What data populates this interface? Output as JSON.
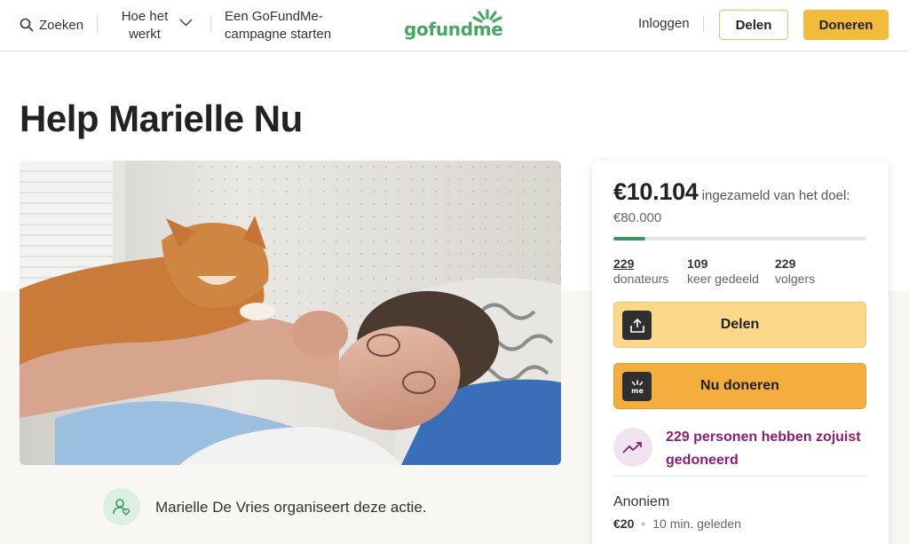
{
  "header": {
    "search_label": "Zoeken",
    "how_it_works_label": "Hoe het werkt",
    "start_campaign_label": "Een GoFundMe-campagne starten",
    "logo_text": "gofundme",
    "login_label": "Inloggen",
    "share_label": "Delen",
    "donate_label": "Doneren"
  },
  "campaign": {
    "title": "Help Marielle Nu",
    "organizer_text": "Marielle De Vries organiseert deze actie."
  },
  "card": {
    "raised_amount": "€10.104",
    "raised_suffix": "ingezameld van het doel:",
    "goal_amount": "€80.000",
    "progress_fraction": 0.126,
    "stats": [
      {
        "number": "229",
        "label": "donateurs"
      },
      {
        "number": "109",
        "label": "keer gedeeld"
      },
      {
        "number": "229",
        "label": "volgers"
      }
    ],
    "share_button_label": "Delen",
    "donate_button_label": "Nu doneren",
    "recent_text": "229 personen hebben zojuist gedoneerd",
    "latest_donation": {
      "name": "Anoniem",
      "amount": "€20",
      "time": "10 min. geleden"
    }
  },
  "colors": {
    "accent_yellow": "#f2bb3b",
    "brand_green": "#4aa567",
    "recent_purple": "#8e1e72"
  }
}
